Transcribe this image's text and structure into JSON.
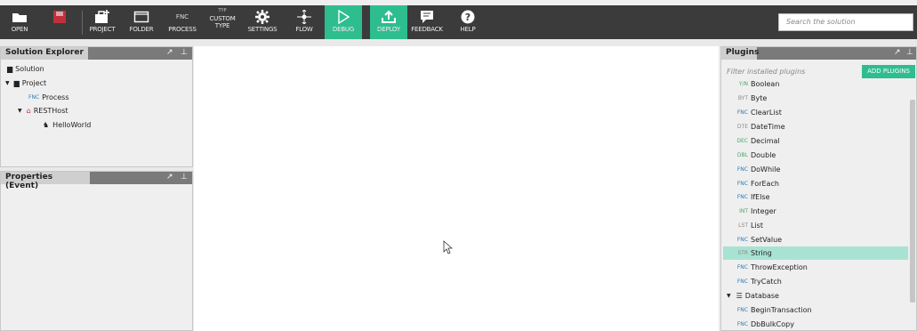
{
  "toolbar": {
    "open": "OPEN",
    "project": "PROJECT",
    "folder": "FOLDER",
    "process_tag": "FNC",
    "process": "PROCESS",
    "custom_tag": "TYP",
    "custom_line1": "CUSTOM",
    "custom_line2": "TYPE",
    "settings": "SETTINGS",
    "flow": "FLOW",
    "debug": "DEBUG",
    "deploy": "DEPLOY",
    "feedback": "FEEDBACK",
    "help": "HELP",
    "search_placeholder": "Search the solution",
    "accent_color": "#2ebd8e",
    "bg_color": "#3b3b3b"
  },
  "solution_explorer": {
    "title": "Solution Explorer",
    "items": [
      {
        "tag": "",
        "label": "Solution"
      },
      {
        "tag": "",
        "label": "Project"
      },
      {
        "tag": "FNC",
        "label": "Process"
      },
      {
        "tag": "",
        "label": "RESTHost"
      },
      {
        "tag": "",
        "label": "HelloWorld"
      }
    ]
  },
  "properties": {
    "title": "Properties (Event)"
  },
  "plugins": {
    "title": "Plugins",
    "filter_placeholder": "Filter installed plugins",
    "add_button": "ADD PLUGINS",
    "items": [
      {
        "tag": "Y/N",
        "label": "Boolean"
      },
      {
        "tag": "BYT",
        "label": "Byte"
      },
      {
        "tag": "FNC",
        "label": "ClearList"
      },
      {
        "tag": "DTE",
        "label": "DateTime"
      },
      {
        "tag": "DEC",
        "label": "Decimal"
      },
      {
        "tag": "DBL",
        "label": "Double"
      },
      {
        "tag": "FNC",
        "label": "DoWhile"
      },
      {
        "tag": "FNC",
        "label": "ForEach"
      },
      {
        "tag": "FNC",
        "label": "IfElse"
      },
      {
        "tag": "INT",
        "label": "Integer"
      },
      {
        "tag": "LST",
        "label": "List"
      },
      {
        "tag": "FNC",
        "label": "SetValue"
      },
      {
        "tag": "STR",
        "label": "String"
      },
      {
        "tag": "FNC",
        "label": "ThrowException"
      },
      {
        "tag": "FNC",
        "label": "TryCatch"
      },
      {
        "tag": "",
        "label": "Database"
      },
      {
        "tag": "FNC",
        "label": "BeginTransaction"
      },
      {
        "tag": "FNC",
        "label": "DbBulkCopy"
      }
    ]
  }
}
